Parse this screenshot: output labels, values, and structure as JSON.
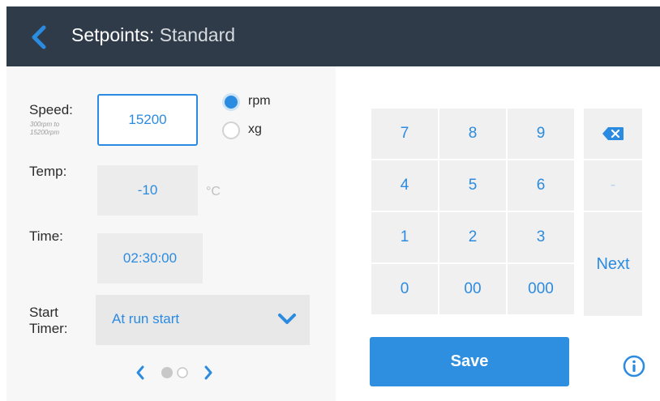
{
  "header": {
    "title_bold": "Setpoints:",
    "title_light": "Standard"
  },
  "form": {
    "speed": {
      "label": "Speed:",
      "hint_line1": "300rpm to",
      "hint_line2": "15200rpm",
      "value": "15200",
      "unit_options": [
        {
          "label": "rpm",
          "selected": true
        },
        {
          "label": "xg",
          "selected": false
        }
      ]
    },
    "temp": {
      "label": "Temp:",
      "value": "-10",
      "unit": "°C"
    },
    "time": {
      "label": "Time:",
      "value": "02:30:00"
    },
    "start_timer": {
      "label_line1": "Start",
      "label_line2": "Timer:",
      "value": "At run start"
    },
    "pager": {
      "current_page": 1,
      "total_pages": 2
    }
  },
  "keypad": {
    "keys": [
      "7",
      "8",
      "9",
      "4",
      "5",
      "6",
      "-",
      "1",
      "2",
      "3",
      "Next",
      "0",
      "00",
      "000"
    ]
  },
  "actions": {
    "save_label": "Save"
  },
  "colors": {
    "header_bg": "#2f3b48",
    "accent": "#2b8be0",
    "key_bg": "#f0f0f0"
  }
}
